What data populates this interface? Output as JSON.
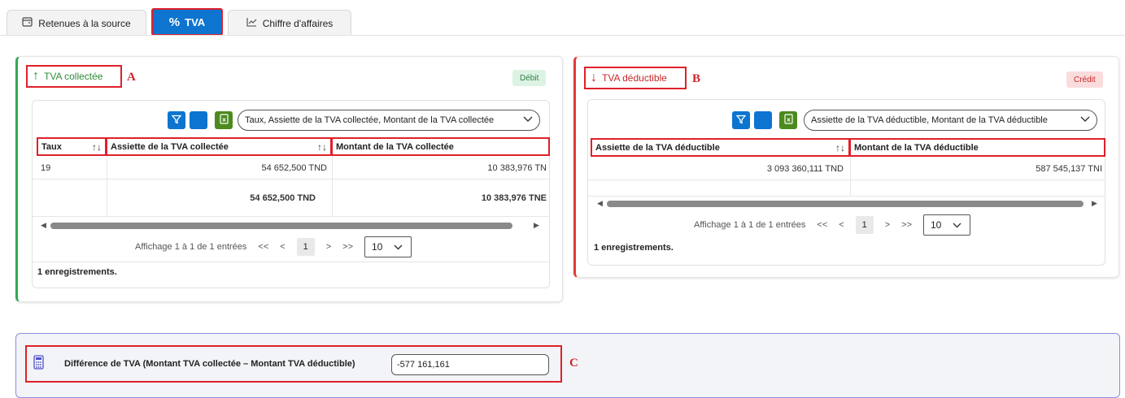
{
  "tabs": [
    {
      "label": "Retenues à la source",
      "icon": "receipt-icon"
    },
    {
      "label": "TVA",
      "icon": "percent-icon",
      "active": true
    },
    {
      "label": "Chiffre d'affaires",
      "icon": "chart-line-icon"
    }
  ],
  "collectee": {
    "title": "TVA collectée",
    "marker": "A",
    "badge": "Débit",
    "accent": "#34a853",
    "columns_selector": "Taux, Assiette de la TVA collectée, Montant de la TVA collectée",
    "headers": [
      "Taux",
      "Assiette de la TVA collectée",
      "Montant de la TVA collectée"
    ],
    "rows": [
      [
        "19",
        "54 652,500 TND",
        "10 383,976 TN"
      ]
    ],
    "totals": [
      "54 652,500 TND",
      "10 383,976 TNE"
    ],
    "pagination": {
      "summary": "Affichage 1 à 1 de 1 entrées",
      "first": "<<",
      "prev": "<",
      "page": "1",
      "next": ">",
      "last": ">>",
      "page_size": "10"
    },
    "records": "1 enregistrements."
  },
  "deductible": {
    "title": "TVA déductible",
    "marker": "B",
    "badge": "Crédit",
    "accent": "#e53935",
    "columns_selector": "Assiette de la TVA déductible, Montant de la TVA déductible",
    "headers": [
      "Assiette de la TVA déductible",
      "Montant de la TVA déductible"
    ],
    "rows": [
      [
        "3 093 360,111 TND",
        "587 545,137 TNI"
      ]
    ],
    "pagination": {
      "summary": "Affichage 1 à 1 de 1 entrées",
      "first": "<<",
      "prev": "<",
      "page": "1",
      "next": ">",
      "last": ">>",
      "page_size": "10"
    },
    "records": "1 enregistrements."
  },
  "difference": {
    "label": "Différence de TVA (Montant TVA collectée – Montant TVA déductible)",
    "value": "-577 161,161",
    "marker": "C"
  },
  "colors": {
    "primary": "#0d74d0",
    "excel": "#4c8a1e",
    "highlight": "#e0202a"
  }
}
